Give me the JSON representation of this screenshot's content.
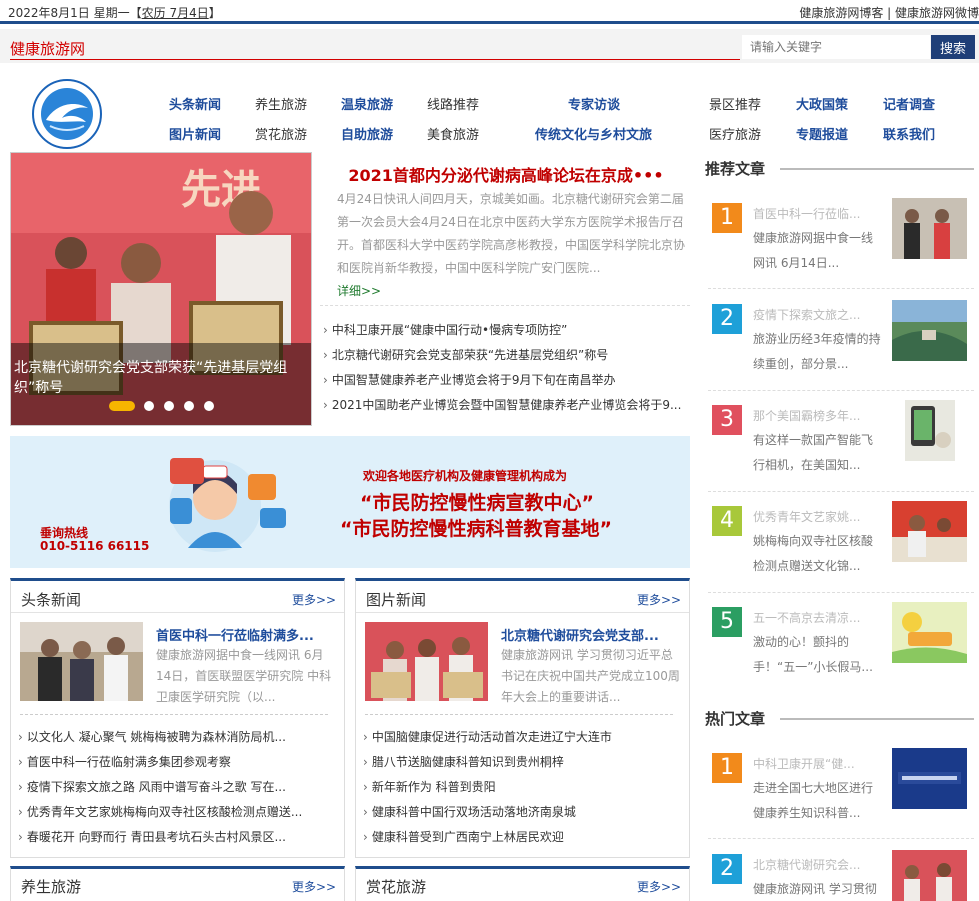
{
  "topbar": {
    "date": "2022年8月1日 星期一【",
    "lunar": "农历 7月4日",
    "date_end": "】",
    "links": "健康旅游网博客 | 健康旅游网微博"
  },
  "brand": "健康旅游网",
  "search": {
    "placeholder": "请输入关键字",
    "button": "搜索"
  },
  "nav": {
    "row1": [
      "头条新闻",
      "养生旅游",
      "温泉旅游",
      "线路推荐",
      "专家访谈",
      "景区推荐",
      "大政国策",
      "记者调查"
    ],
    "row2": [
      "图片新闻",
      "赏花旅游",
      "自助旅游",
      "美食旅游",
      "传统文化与乡村文旅",
      "医疗旅游",
      "专题报道",
      "联系我们"
    ]
  },
  "slider": {
    "caption": "北京糖代谢研究会党支部荣获“先进基层党组织”称号",
    "sign_text": "先进"
  },
  "headline": {
    "title": "2021首都内分泌代谢病高峰论坛在京成•••",
    "summary": "4月24日快讯人间四月天，京城美如画。北京糖代谢研究会第二届第一次会员大会4月24日在北京中医药大学东方医院学术报告厅召开。首都医科大学中医药学院高彦彬教授，中国医学科学院北京协和医院肖新华教授，中国中医科学院广安门医院...",
    "more": "详细>>",
    "list": [
      "中科卫康开展“健康中国行动•慢病专项防控”",
      "北京糖代谢研究会党支部荣获“先进基层党组织”称号",
      "中国智慧健康养老产业博览会将于9月下旬在南昌举办",
      "2021中国助老产业博览会暨中国智慧健康养老产业博览会将于9..."
    ]
  },
  "banner": {
    "line1": "欢迎各地医疗机构及健康管理机构成为",
    "line2": "“市民防控慢性病宣教中心”",
    "line3": "“市民防控慢性病科普教育基地”",
    "hotline_label": "垂询热线",
    "hotline": "010-5116 66115"
  },
  "box_toutiao": {
    "title": "头条新闻",
    "more": "更多>>",
    "feature_title": "首医中科一行莅临射满多...",
    "feature_desc": "健康旅游网据中食一线网讯 6月14日，首医联盟医学研究院 中科卫康医学研究院（以...",
    "list": [
      "以文化人 凝心聚气 姚梅梅被聘为森林消防局机...",
      "首医中科一行莅临射满多集团参观考察",
      "疫情下探索文旅之路 风雨中谱写奋斗之歌 写在...",
      "优秀青年文艺家姚梅梅向双寺社区核酸检测点赠送...",
      "春暖花开 向野而行 青田县考坑石头古村风景区..."
    ]
  },
  "box_tupian": {
    "title": "图片新闻",
    "more": "更多>>",
    "feature_title": "北京糖代谢研究会党支部...",
    "feature_desc": "健康旅游网讯 学习贯彻习近平总书记在庆祝中国共产党成立100周年大会上的重要讲话...",
    "list": [
      "中国脑健康促进行动活动首次走进辽宁大连市",
      "腊八节送脑健康科普知识到贵州桐梓",
      "新年新作为 科普到贵阳",
      "健康科普中国行双场活动落地济南泉城",
      "健康科普受到广西南宁上林居民欢迎"
    ]
  },
  "box_yangsheng": {
    "title": "养生旅游",
    "more": "更多>>"
  },
  "box_shanghua": {
    "title": "赏花旅游",
    "more": "更多>>"
  },
  "sidebar": {
    "recommend_title": "推荐文章",
    "recommend": [
      {
        "num": "1",
        "title": "首医中科一行莅临...",
        "desc": "健康旅游网据中食一线网讯 6月14日..."
      },
      {
        "num": "2",
        "title": "疫情下探索文旅之...",
        "desc": "旅游业历经3年疫情的持续重创，部分景..."
      },
      {
        "num": "3",
        "title": "那个美国霸榜多年...",
        "desc": "有这样一款国产智能飞行相机，在美国知..."
      },
      {
        "num": "4",
        "title": "优秀青年文艺家姚...",
        "desc": "姚梅梅向双寺社区核酸检测点赠送文化锦..."
      },
      {
        "num": "5",
        "title": "五一不高京去清凉...",
        "desc": "激动的心！颤抖的手！“五一”小长假马..."
      }
    ],
    "hot_title": "热门文章",
    "hot": [
      {
        "num": "1",
        "title": "中科卫康开展“健...",
        "desc": "走进全国七大地区进行健康养生知识科普..."
      },
      {
        "num": "2",
        "title": "北京糖代谢研究会...",
        "desc": "健康旅游网讯 学习贯彻"
      }
    ]
  },
  "colors": {
    "nav_blue": "#1f4d9c",
    "headline_red": "#c00000",
    "brand_red": "#d20000",
    "num_orange": "#f28a1b",
    "num_blue": "#1ea0d8",
    "num_red": "#e0505e",
    "num_green": "#a8c83a",
    "num_teal": "#2b9e62"
  }
}
